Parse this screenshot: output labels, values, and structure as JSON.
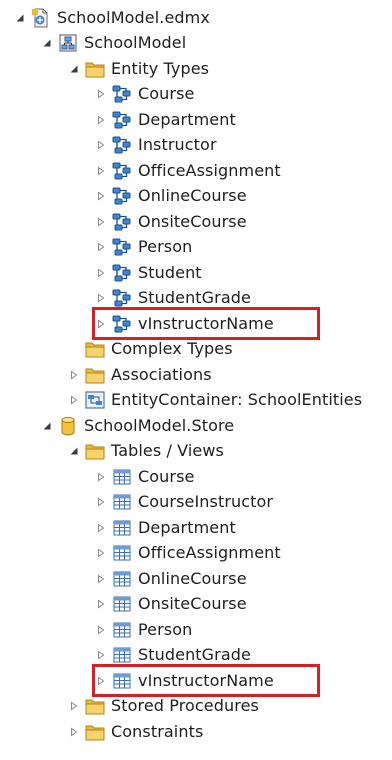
{
  "tree": {
    "root": {
      "label": "SchoolModel.edmx",
      "icon": "edmx-file-icon"
    },
    "conceptual_model": {
      "label": "SchoolModel",
      "icon": "model-diagram-icon",
      "entity_types": {
        "label": "Entity Types",
        "icon": "folder-icon",
        "items": [
          "Course",
          "Department",
          "Instructor",
          "OfficeAssignment",
          "OnlineCourse",
          "OnsiteCourse",
          "Person",
          "Student",
          "StudentGrade",
          "vInstructorName"
        ]
      },
      "complex_types": {
        "label": "Complex Types",
        "icon": "folder-icon"
      },
      "associations": {
        "label": "Associations",
        "icon": "folder-icon"
      },
      "entity_container": {
        "label": "EntityContainer: SchoolEntities",
        "icon": "entity-container-icon"
      }
    },
    "store_model": {
      "label": "SchoolModel.Store",
      "icon": "database-icon",
      "tables_views": {
        "label": "Tables / Views",
        "icon": "folder-icon",
        "items": [
          "Course",
          "CourseInstructor",
          "Department",
          "OfficeAssignment",
          "OnlineCourse",
          "OnsiteCourse",
          "Person",
          "StudentGrade",
          "vInstructorName"
        ]
      },
      "stored_procedures": {
        "label": "Stored Procedures",
        "icon": "folder-icon"
      },
      "constraints": {
        "label": "Constraints",
        "icon": "folder-icon"
      }
    }
  },
  "highlight_color": "#d62026"
}
